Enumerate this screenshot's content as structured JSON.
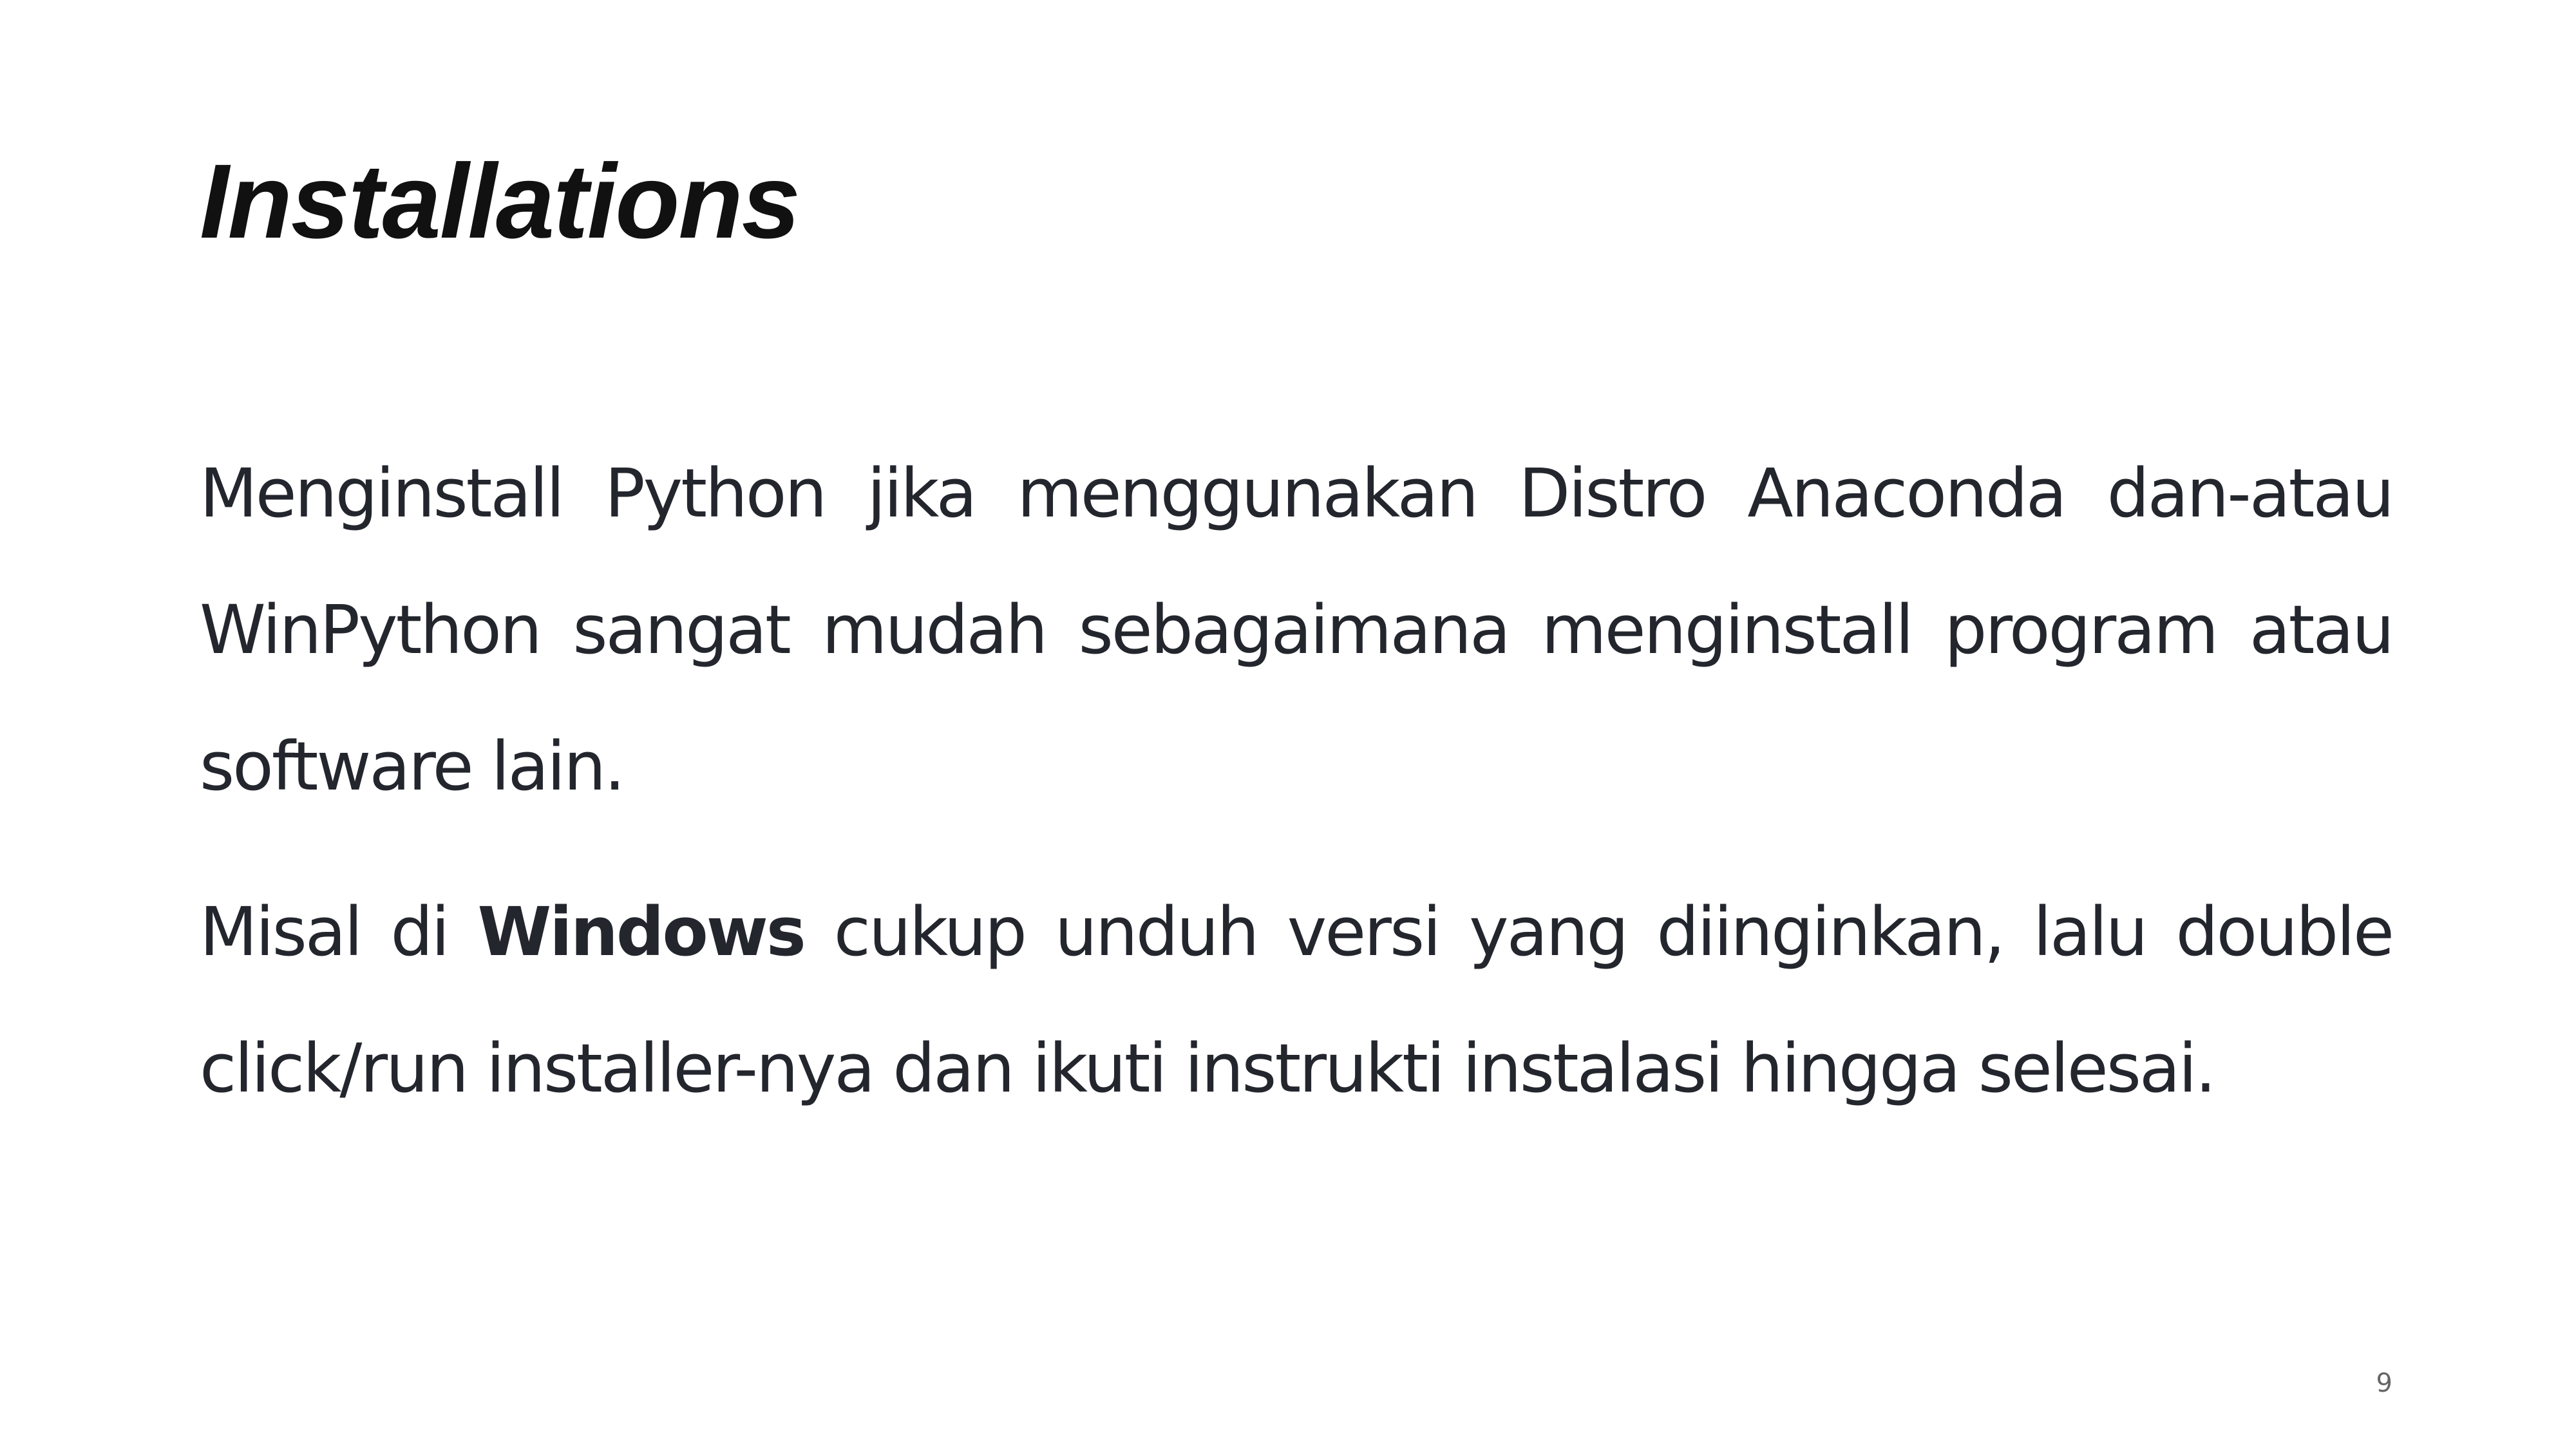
{
  "slide": {
    "title": "Installations",
    "paragraphs": [
      {
        "text": "Menginstall Python jika menggunakan Distro Anaconda dan-atau WinPython sangat mudah sebagaimana menginstall program atau software lain."
      },
      {
        "before": "Misal di ",
        "bold": "Windows",
        "after": " cukup unduh versi yang diinginkan, lalu double click/run installer-nya dan ikuti instrukti instalasi hingga selesai."
      }
    ],
    "page_number": "9"
  }
}
